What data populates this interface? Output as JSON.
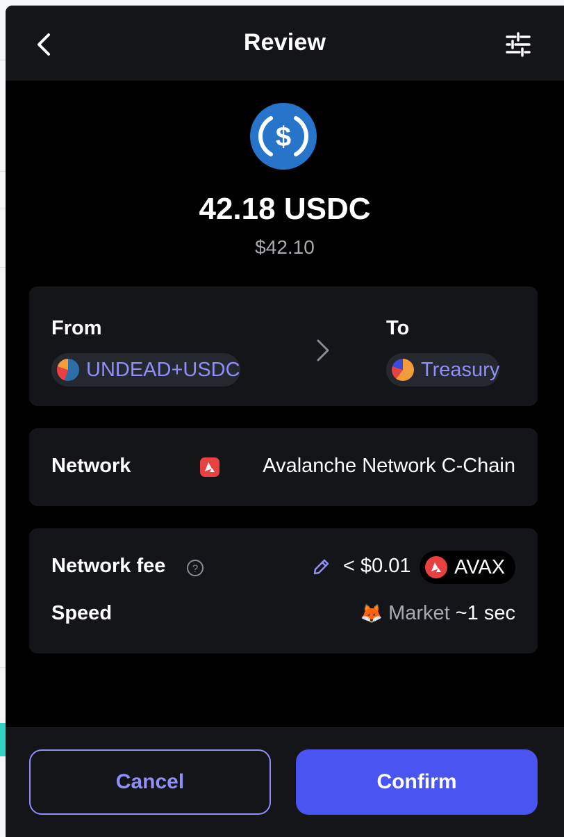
{
  "header": {
    "title": "Review",
    "back_icon": "chevron-left-icon",
    "settings_icon": "sliders-icon"
  },
  "token": {
    "icon": "usdc-icon",
    "amount": "42.18 USDC",
    "fiat": "$42.10",
    "icon_color": "#2775ca"
  },
  "route": {
    "from_label": "From",
    "from_account": "UNDEAD+USDC",
    "to_label": "To",
    "to_account": "Treasury",
    "arrow_icon": "chevron-right-icon"
  },
  "network": {
    "label": "Network",
    "name": "Avalanche Network C-Chain",
    "icon": "avalanche-icon"
  },
  "fee": {
    "label": "Network fee",
    "help_icon": "question-circle-icon",
    "edit_icon": "pencil-icon",
    "value": "< $0.01",
    "token": "AVAX",
    "speed_label": "Speed",
    "speed_icon": "fox-icon",
    "speed_mode": "Market",
    "speed_time": "~1 sec"
  },
  "actions": {
    "cancel": "Cancel",
    "confirm": "Confirm"
  },
  "colors": {
    "accent": "#4a54f1",
    "link": "#8f8ff7",
    "avalanche": "#e84142",
    "card": "#141518"
  }
}
